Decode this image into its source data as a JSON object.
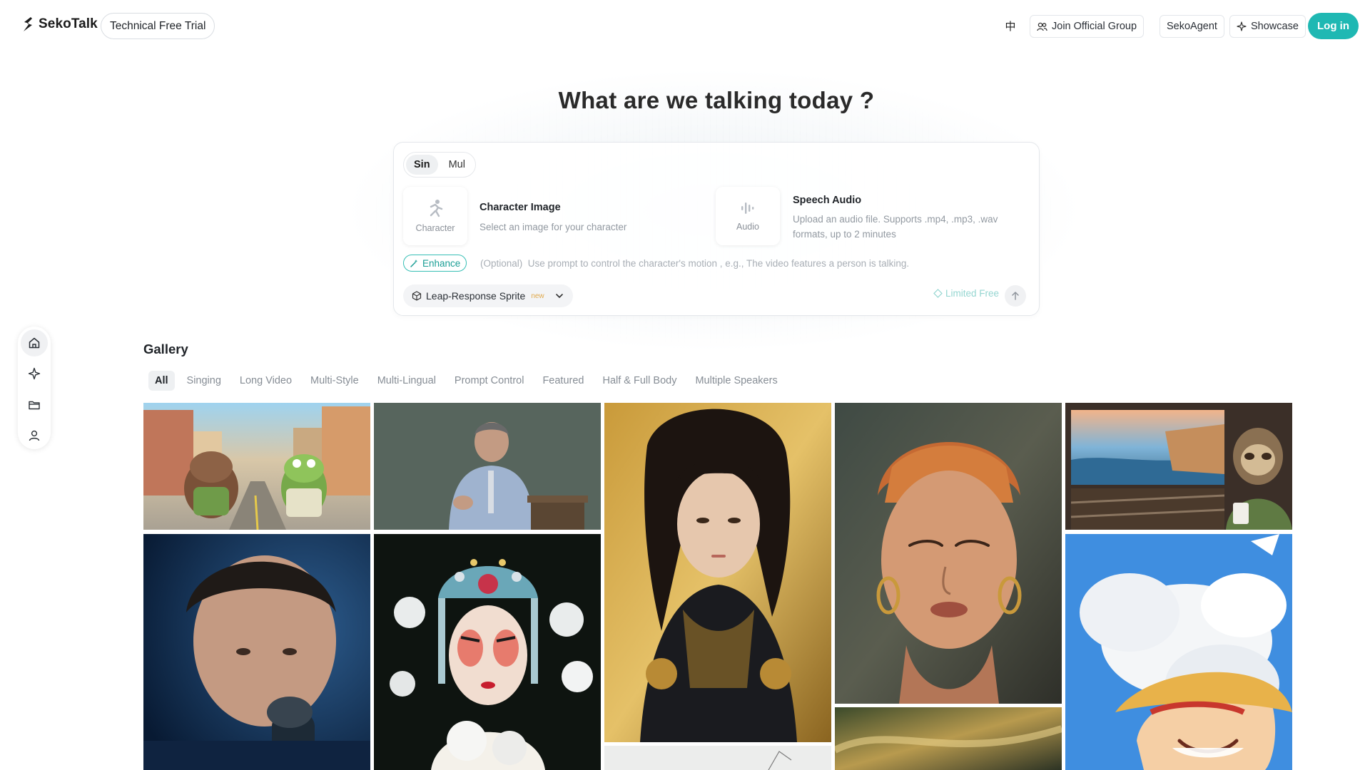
{
  "header": {
    "brand": "SekoTalk",
    "trial_badge": "Technical Free Trial",
    "lang_toggle": "中",
    "join_group": "Join Official Group",
    "seko_agent": "SekoAgent",
    "showcase": "Showcase",
    "login": "Log in"
  },
  "hero": {
    "title": "What are we talking today ?"
  },
  "composer": {
    "mode_options": [
      "Sin",
      "Mul"
    ],
    "mode_selected": "Sin",
    "character": {
      "tile_label": "Character",
      "title": "Character Image",
      "desc": "Select an image for your character"
    },
    "audio": {
      "tile_label": "Audio",
      "title": "Speech Audio",
      "desc": "Upload an audio file. Supports .mp4, .mp3, .wav formats, up to 2 minutes"
    },
    "enhance_label": "Enhance",
    "prompt_placeholder": "(Optional)  Use prompt to control the character's motion , e.g., The video features a person is talking.",
    "model": "Leap-Response Sprite",
    "model_tag": "new",
    "limited_free": "Limited Free"
  },
  "sidenav": {
    "items": [
      "home-icon",
      "sparkle-icon",
      "folder-icon",
      "user-icon"
    ],
    "active": "home-icon"
  },
  "gallery": {
    "title": "Gallery",
    "filters": [
      "All",
      "Singing",
      "Long Video",
      "Multi-Style",
      "Multi-Lingual",
      "Prompt Control",
      "Featured",
      "Half & Full Body",
      "Multiple Speakers"
    ],
    "active_filter": "All",
    "items": [
      "cartoon-boar-and-frog-street",
      "speaker-at-podium",
      "long-haired-man-golden-robe",
      "painted-woman-headscarf",
      "sloth-officer-on-train",
      "young-man-singing-microphone",
      "peking-opera-performer",
      "anime-boy-straw-hat-clouds",
      "abstract-gold-texture",
      "white-sketch-artwork"
    ]
  },
  "colors": {
    "accent": "#1fb8b3",
    "enhance": "#1a9e95",
    "limited_free": "#95d6d1"
  }
}
